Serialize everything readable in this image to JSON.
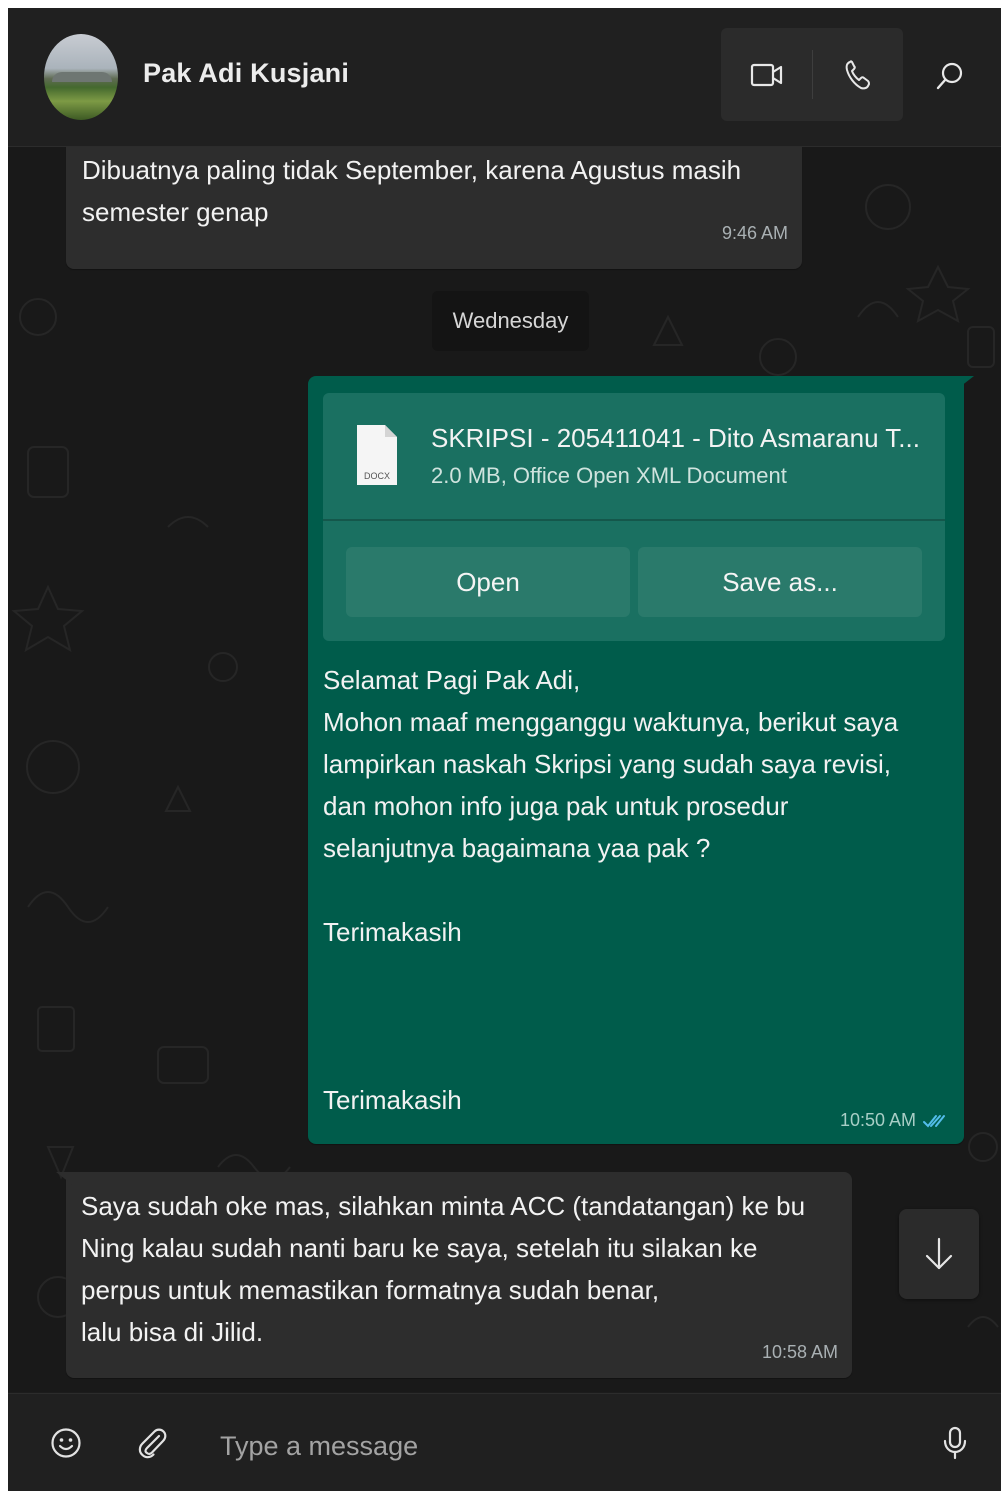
{
  "header": {
    "contact_name": "Pak Adi Kusjani",
    "avatar_icon": "contact-photo-landscape",
    "video_call_icon": "video-camera-icon",
    "voice_call_icon": "phone-icon",
    "search_icon": "search-icon"
  },
  "messages": {
    "msg1": {
      "text": "Dibuatnya paling tidak September, karena Agustus masih\nsemester genap",
      "time": "9:46 AM"
    },
    "date_separator": "Wednesday",
    "msg2": {
      "file": {
        "name": "SKRIPSI - 205411041 - Dito Asmaranu T...",
        "meta": "2.0 MB, Office Open XML Document",
        "type_badge": "DOCX",
        "open_label": "Open",
        "save_label": "Save as..."
      },
      "text": "Selamat Pagi Pak Adi,\nMohon maaf mengganggu waktunya, berikut saya\nlampirkan naskah Skripsi yang sudah saya revisi,\ndan mohon info juga pak untuk prosedur\nselanjutnya bagaimana yaa pak ?\n\nTerimakasih",
      "text2": "Terimakasih",
      "time": "10:50 AM",
      "status": "read",
      "status_color": "#53bdeb"
    },
    "msg3": {
      "text": "Saya sudah oke mas, silahkan minta ACC (tandatangan) ke bu\nNing kalau sudah nanti baru ke saya, setelah itu silakan ke\nperpus untuk memastikan formatnya sudah benar,\nlalu bisa di Jilid.",
      "time": "10:58 AM"
    }
  },
  "composer": {
    "placeholder": "Type a message",
    "emoji_icon": "emoji-icon",
    "attach_icon": "paperclip-icon",
    "mic_icon": "microphone-icon"
  },
  "colors": {
    "background": "#1c1c1c",
    "header": "#202020",
    "incoming_bubble": "#2d2d2d",
    "outgoing_bubble": "#005c4b",
    "file_card": "#1a7061",
    "read_ticks": "#53bdeb"
  }
}
